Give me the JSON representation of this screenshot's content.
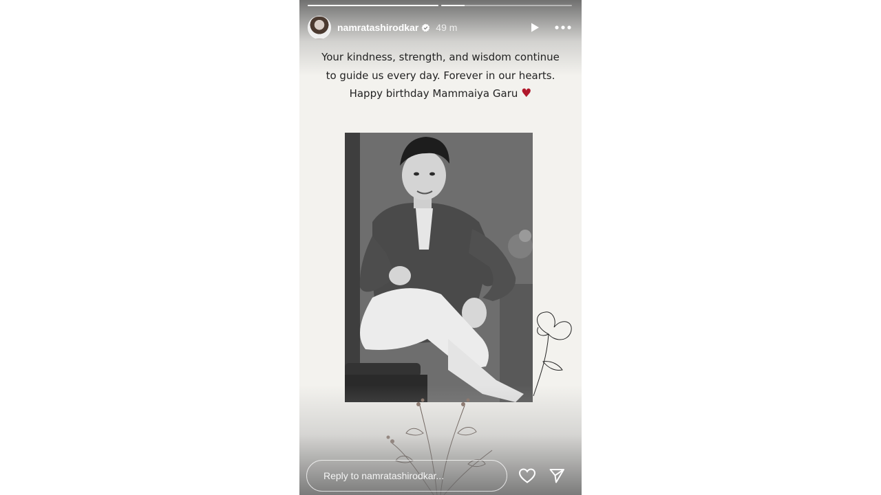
{
  "story": {
    "progress": [
      1.0,
      0.18
    ],
    "user": {
      "username": "namratashirodkar",
      "verified": true,
      "time": "49 m"
    },
    "caption": {
      "lines": [
        "Your kindness, strength, and wisdom continue",
        "to guide us every day. Forever in our hearts.",
        "Happy birthday Mammaiya Garu"
      ],
      "emoji": "♥"
    },
    "reply": {
      "placeholder": "Reply to namratashirodkar..."
    }
  },
  "colors": {
    "background": "#f3f2ee",
    "heart": "#b0182b",
    "text": "#222222"
  },
  "icons": {
    "play": "play-icon",
    "more": "more-options-icon",
    "like": "heart-outline-icon",
    "share": "send-icon",
    "verified": "verified-badge-icon"
  }
}
